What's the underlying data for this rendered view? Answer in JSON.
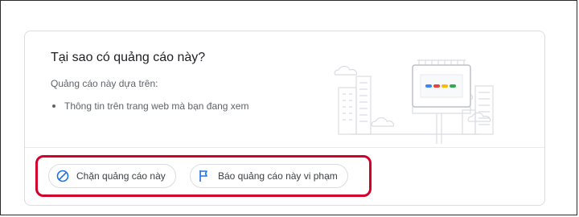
{
  "card": {
    "title": "Tại sao có quảng cáo này?",
    "based_on": "Quảng cáo này dựa trên:",
    "reasons": [
      "Thông tin trên trang web mà bạn đang xem"
    ]
  },
  "actions": {
    "block_label": "Chặn quảng cáo này",
    "report_label": "Báo quảng cáo này vi phạm"
  },
  "icons": {
    "block": "block-icon",
    "report": "flag-icon"
  },
  "colors": {
    "accent_blue": "#1a73e8",
    "highlight_red": "#d3002c",
    "dot_blue": "#4285f4",
    "dot_red": "#ea4335",
    "dot_yellow": "#fbbc04",
    "dot_green": "#34a853"
  }
}
